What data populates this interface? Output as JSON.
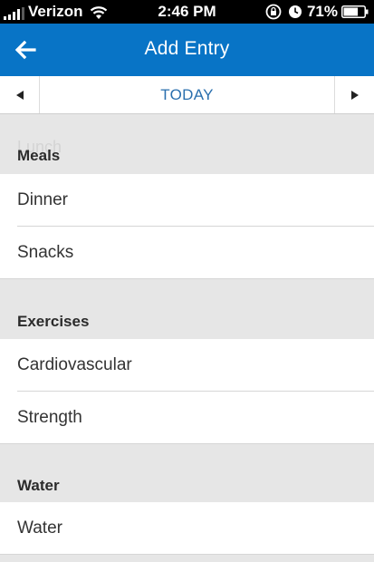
{
  "status_bar": {
    "carrier": "Verizon",
    "time": "2:46 PM",
    "battery_percent": "71%",
    "signal_bars": 4,
    "battery_level": 0.71
  },
  "nav": {
    "title": "Add Entry",
    "back_icon": "arrow-left-icon"
  },
  "date_bar": {
    "label": "TODAY",
    "prev_icon": "triangle-left-icon",
    "next_icon": "triangle-right-icon"
  },
  "ghost_text": "Lunch",
  "sections": [
    {
      "title": "Meals",
      "items": [
        "Dinner",
        "Snacks"
      ]
    },
    {
      "title": "Exercises",
      "items": [
        "Cardiovascular",
        "Strength"
      ]
    },
    {
      "title": "Water",
      "items": [
        "Water"
      ]
    }
  ]
}
